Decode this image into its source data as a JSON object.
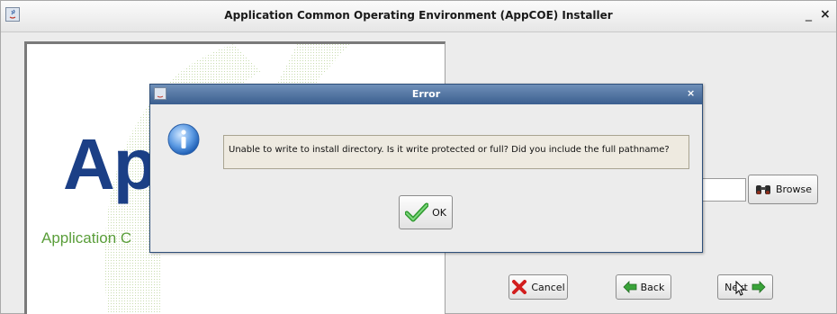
{
  "window": {
    "title": "Application Common Operating Environment (AppCOE) Installer",
    "minimize_glyph": "_",
    "close_glyph": "×"
  },
  "logo": {
    "big_text": "Ap",
    "sub_text": "Application C"
  },
  "install_path": {
    "value": ""
  },
  "buttons": {
    "browse": "Browse",
    "cancel": "Cancel",
    "back": "Back",
    "next": "Next"
  },
  "dialog": {
    "title": "Error",
    "close_glyph": "×",
    "message": "Unable to write to install directory. Is it write protected or full? Did you include the full pathname?",
    "ok_label": "OK"
  },
  "colors": {
    "dialog_title": "#3b5f8f",
    "logo_blue": "#1b3f86",
    "logo_green": "#5a9e3a"
  }
}
